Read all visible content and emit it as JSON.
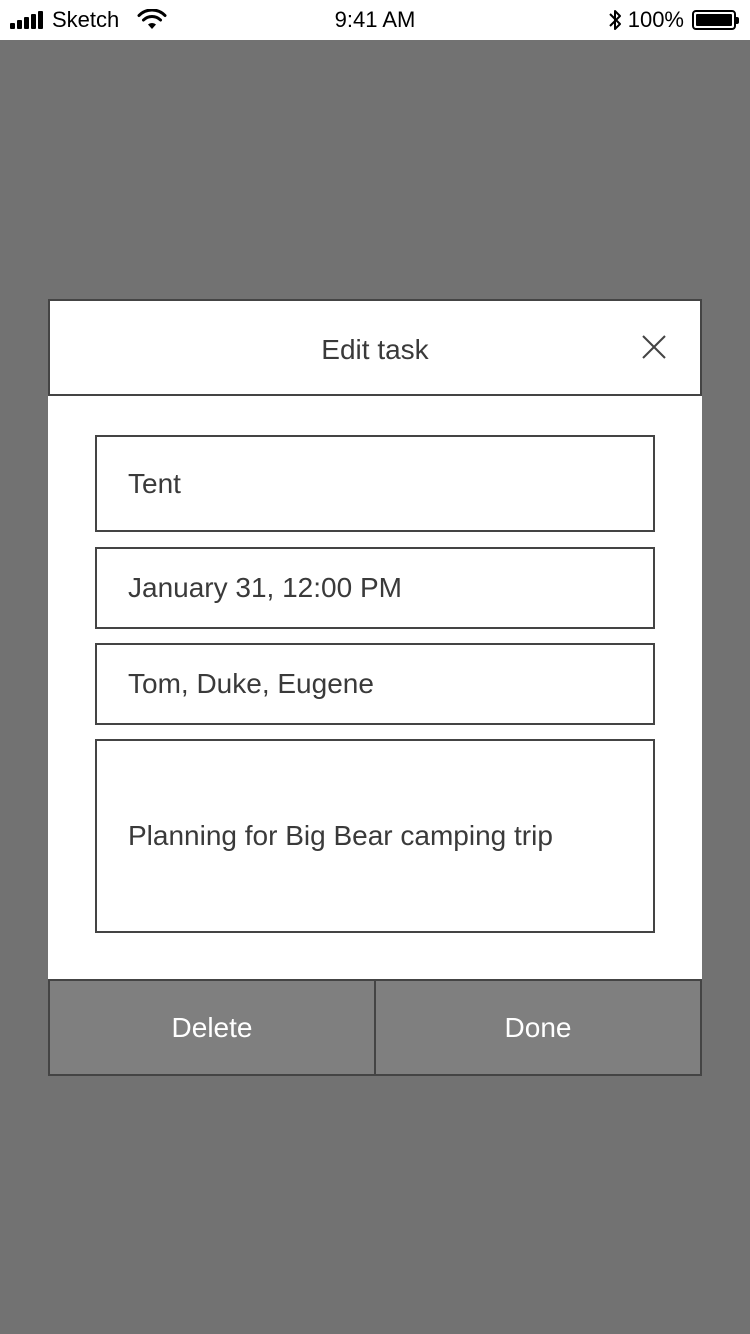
{
  "status_bar": {
    "carrier": "Sketch",
    "time": "9:41 AM",
    "battery_percent": "100%"
  },
  "modal": {
    "title": "Edit task",
    "close_icon": "close-icon",
    "fields": {
      "name": "Tent",
      "datetime": "January 31, 12:00 PM",
      "assignees": "Tom, Duke, Eugene",
      "notes": "Planning for Big Bear camping trip"
    },
    "buttons": {
      "delete": "Delete",
      "done": "Done"
    }
  },
  "colors": {
    "backdrop": "#727272",
    "button_bg": "#7f7f7f",
    "border": "#444444",
    "text": "#3a3a3a"
  }
}
